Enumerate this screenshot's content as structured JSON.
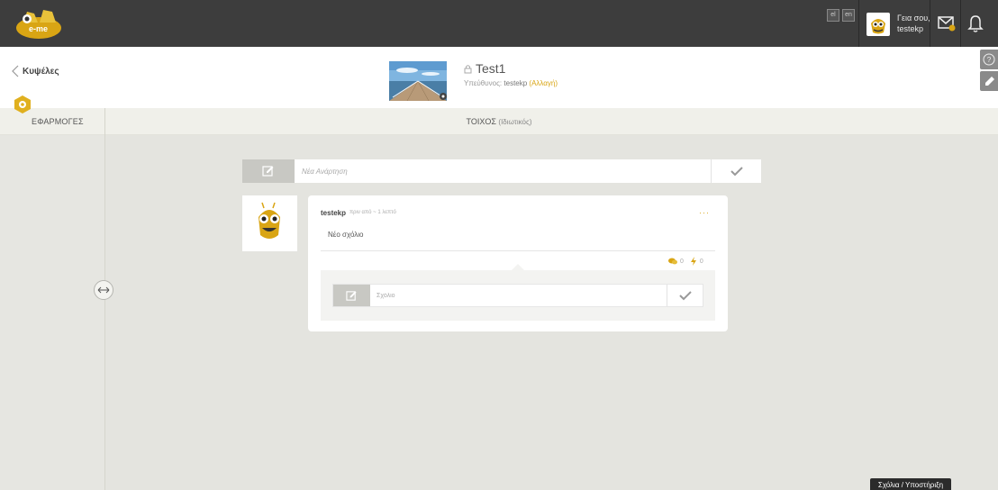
{
  "topbar": {
    "logo_text": "e-me",
    "lang_el": "el",
    "lang_en": "en",
    "greeting": "Γεια σου,",
    "username": "testekp"
  },
  "header": {
    "back_label": "Κυψέλες",
    "group_title": "Test1",
    "owner_prefix": "Υπεύθυνος:",
    "owner_name": "testekp",
    "change_label": "(Αλλαγή)"
  },
  "apps": {
    "label": "ΕΦΑΡΜΟΓΕΣ"
  },
  "wall": {
    "title": "ΤΟΙΧΟΣ",
    "subtitle": "(Ιδιωτικός)"
  },
  "newpost": {
    "placeholder": "Νέα Ανάρτηση"
  },
  "post": {
    "author": "testekp",
    "time": "πριν από ~ 1 λεπτό",
    "text": "Νέο σχόλιο",
    "more": "···",
    "comments_count": "0",
    "likes_count": "0"
  },
  "comment": {
    "placeholder": "Σχόλιο"
  },
  "feedback": {
    "label": "Σχόλια / Υποστήριξη"
  },
  "colors": {
    "accent": "#d9a514",
    "topbar": "#3d3d3d",
    "canvas": "#e4e4df"
  }
}
